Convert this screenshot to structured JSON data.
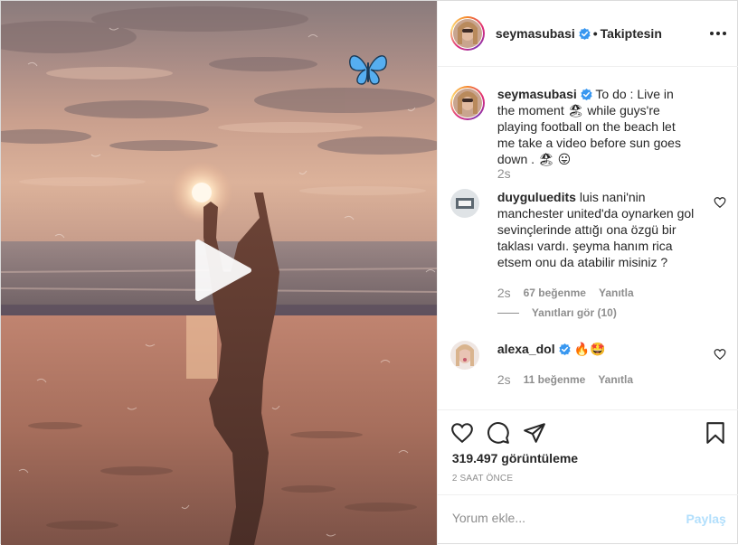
{
  "post": {
    "username": "seymasubasi",
    "follow_separator": "•",
    "follow_state": "Takiptesin",
    "more_icon": "more-options-icon",
    "caption": {
      "username": "seymasubasi",
      "text_1": "To do : Live in the moment",
      "text_2": "while guys're playing football on the beach let me take a video before sun goes down .",
      "emoji_beach": "🏖",
      "emoji_tongue": "😛",
      "time": "2s"
    }
  },
  "comments": [
    {
      "username": "duyguluedits",
      "text": "luis nani'nin manchester united'da oynarken gol sevinçlerinde attığı ona özgü bir taklası vardı. şeyma hanım rica etsem onu da atabilir misiniz ?",
      "time": "2s",
      "likes": "67 beğenme",
      "reply": "Yanıtla",
      "view_replies": "Yanıtları gör (10)"
    },
    {
      "username": "alexa_dol",
      "text": "🔥🤩",
      "time": "2s",
      "likes": "11 beğenme",
      "reply": "Yanıtla"
    }
  ],
  "actions": {
    "like_icon": "heart-icon",
    "comment_icon": "comment-icon",
    "share_icon": "share-icon",
    "save_icon": "bookmark-icon"
  },
  "views": "319.497 görüntüleme",
  "timestamp": "2 SAAT ÖNCE",
  "add_comment": {
    "placeholder": "Yorum ekle...",
    "post_label": "Paylaş"
  },
  "colors": {
    "verified": "#3897f0",
    "post_button_disabled": "#b2dffc",
    "muted_text": "#8e8e8e"
  }
}
